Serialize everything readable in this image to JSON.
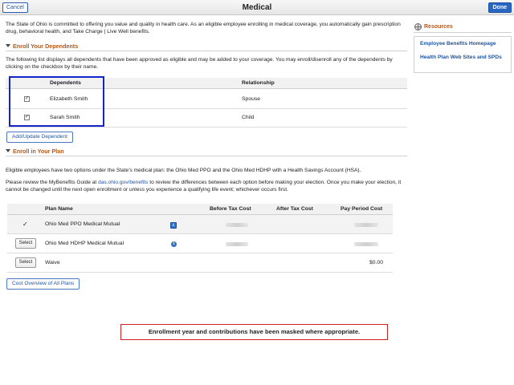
{
  "header": {
    "title": "Medical",
    "cancel_label": "Cancel",
    "done_label": "Done"
  },
  "intro": "The State of Ohio is committed to offering you value and quality in health care. As an eligible employee enrolling in medical coverage, you automatically gain prescription drug, behavioral health, and Take Charge | Live Well benefits.",
  "dependents_section": {
    "heading": "Enroll Your Dependents",
    "description": "The following list displays all dependents that have been approved as eligible and may be added to your coverage. You may enroll/disenroll any of the dependents by clicking on the checkbox by their name.",
    "columns": [
      "Dependents",
      "Relationship"
    ],
    "rows": [
      {
        "name": "Elizabeth Smith",
        "relationship": "Spouse",
        "checked": true
      },
      {
        "name": "Sarah Smith",
        "relationship": "Child",
        "checked": true
      }
    ],
    "checkmark": "✓",
    "add_button": "Add/Update Dependent"
  },
  "plan_section": {
    "heading": "Enroll in Your Plan",
    "para1": "Eligible employees have two options under the State's medical plan: the Ohio Med PPO and the Ohio Med HDHP with a Health Savings Account (HSA).",
    "para2_before": "Please review the MyBenefits Guide at ",
    "para2_link": "das.ohio.gov/benefits",
    "para2_after": " to review the differences between each option before making your election. Once you make your election, it cannot be changed until the next open enrollment or unless you experience a qualifying life event; whichever occurs first.",
    "columns": {
      "plan_name": "Plan Name",
      "before_tax": "Before Tax Cost",
      "after_tax": "After Tax Cost",
      "pay_period": "Pay Period Cost"
    },
    "rows": [
      {
        "selected": true,
        "mark": "✓",
        "plan": "Ohio Med PPO Medical Mutual",
        "has_info": true,
        "pay_period": ""
      },
      {
        "selected": false,
        "select_label": "Select",
        "plan": "Ohio Med HDHP Medical Mutual",
        "has_info": true,
        "pay_period": ""
      },
      {
        "selected": false,
        "select_label": "Select",
        "plan": "Waive",
        "has_info": false,
        "pay_period": "$0.00"
      }
    ],
    "info_glyph": "i",
    "cost_button": "Cost Overview of All Plans"
  },
  "resources": {
    "heading": "Resources",
    "links": [
      "Employee Benefits Homepage",
      "Health Plan Web Sites and SPDs"
    ]
  },
  "notice": "Enrollment year and contributions have been masked where appropriate.",
  "colors": {
    "accent_blue": "#1f55a6",
    "section_orange": "#b5571a",
    "highlight_border": "#1525c8",
    "notice_border": "#cc2222"
  }
}
